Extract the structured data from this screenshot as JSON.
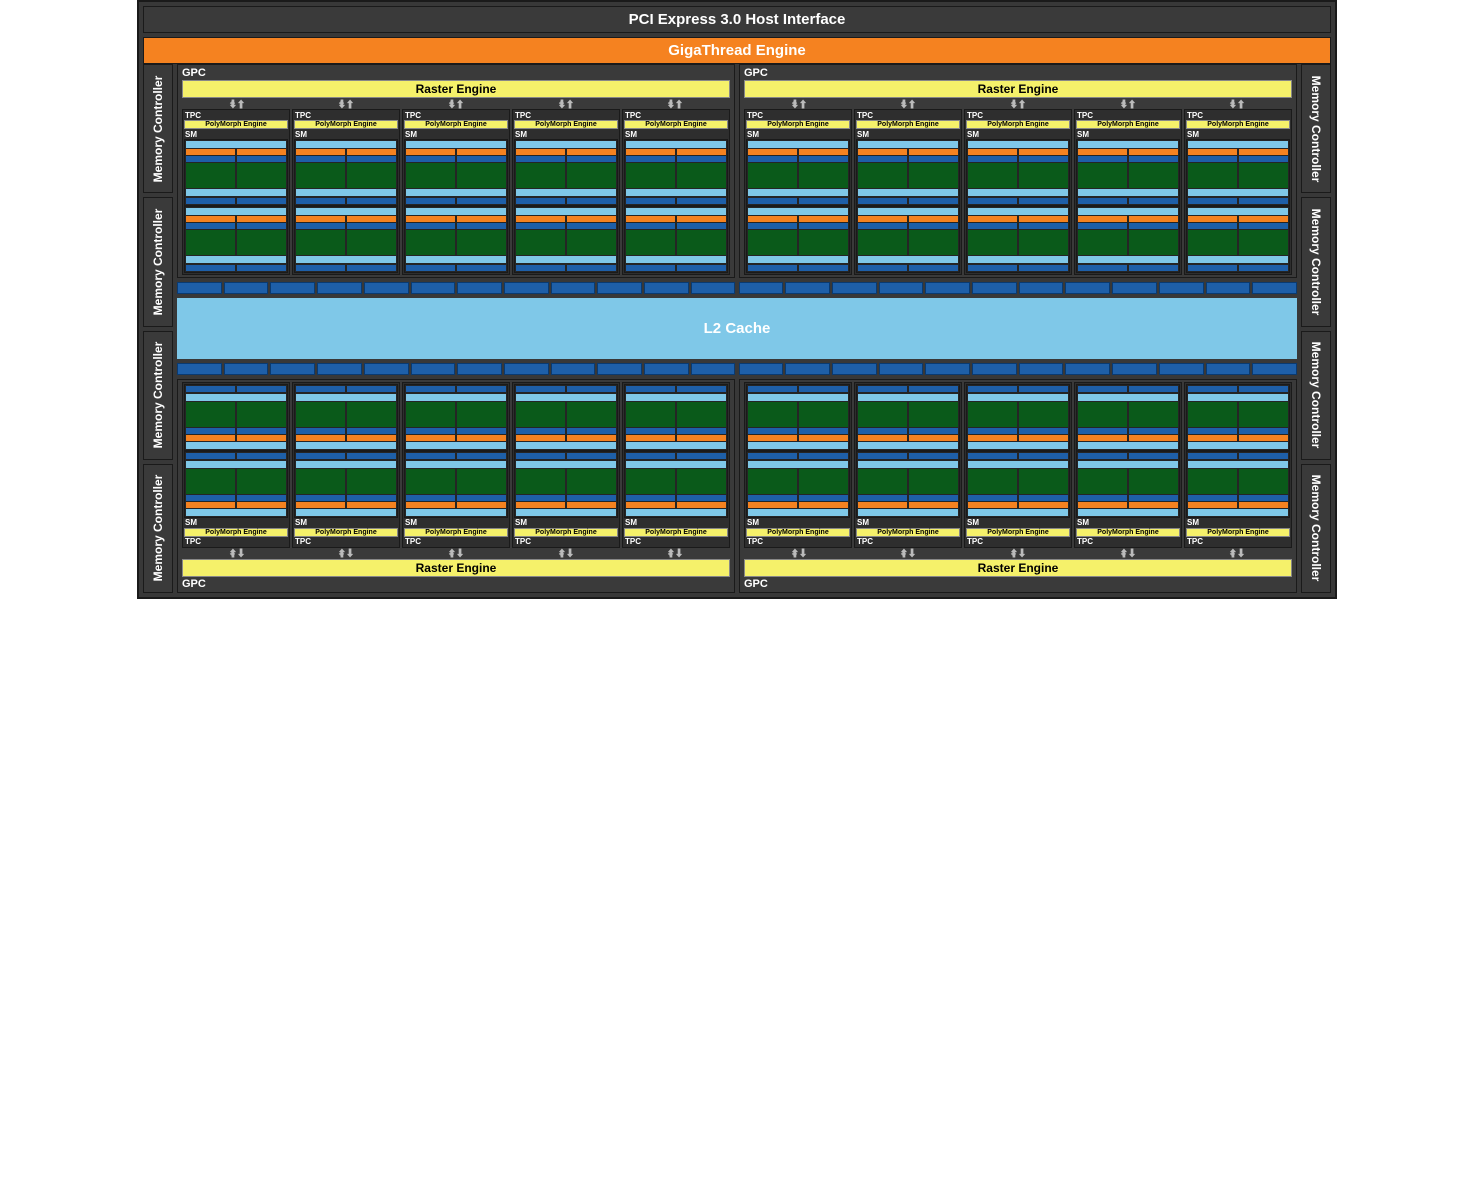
{
  "pci": "PCI Express 3.0 Host Interface",
  "giga": "GigaThread Engine",
  "mem": "Memory Controller",
  "gpc": "GPC",
  "raster": "Raster Engine",
  "tpc": "TPC",
  "poly": "PolyMorph Engine",
  "sm": "SM",
  "l2": "L2 Cache",
  "counts": {
    "gpcs": 4,
    "tpcs_per_gpc": 5,
    "sms_per_tpc": 2,
    "mem_controllers": 8,
    "core_cols_per_sm": 2,
    "core_grid_per_col": "4x8"
  }
}
